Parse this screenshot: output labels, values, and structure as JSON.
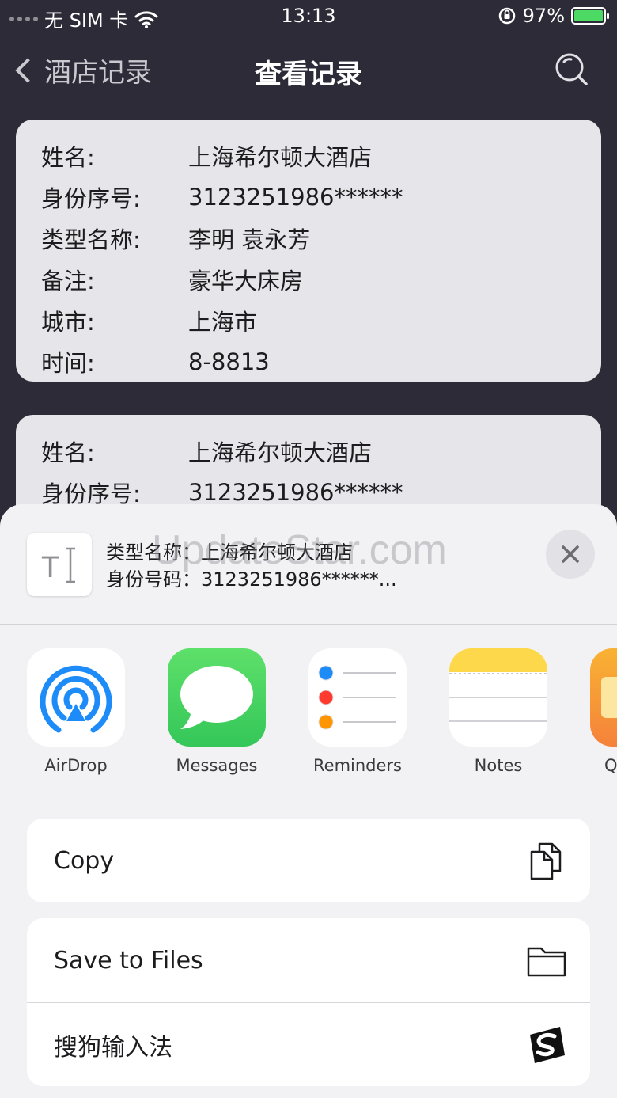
{
  "status_bar": {
    "carrier": "无 SIM 卡",
    "time": "13:13",
    "battery_pct": "97%",
    "icons": [
      "signal-dots-icon",
      "wifi-icon",
      "orientation-lock-icon",
      "battery-charging-icon"
    ]
  },
  "nav": {
    "back_label": "酒店记录",
    "title": "查看记录",
    "search_icon": "search-icon"
  },
  "records": [
    {
      "rows": [
        {
          "key": "姓名:",
          "value": "上海希尔顿大酒店"
        },
        {
          "key": "身份序号:",
          "value": "3123251986******"
        },
        {
          "key": "类型名称:",
          "value": "李明 袁永芳"
        },
        {
          "key": "备注:",
          "value": "豪华大床房"
        },
        {
          "key": "城市:",
          "value": "上海市"
        },
        {
          "key": "时间:",
          "value": "8-8813"
        }
      ]
    },
    {
      "rows": [
        {
          "key": "姓名:",
          "value": "上海希尔顿大酒店"
        },
        {
          "key": "身份序号:",
          "value": "3123251986******"
        }
      ]
    }
  ],
  "share_sheet": {
    "preview_line1": "类型名称：上海希尔顿大酒店",
    "preview_line2": "身份号码：3123251986******...",
    "watermark": "UpdateStar.com",
    "apps": [
      {
        "label": "AirDrop",
        "icon": "airdrop-icon"
      },
      {
        "label": "Messages",
        "icon": "messages-icon"
      },
      {
        "label": "Reminders",
        "icon": "reminders-icon"
      },
      {
        "label": "Notes",
        "icon": "notes-icon"
      },
      {
        "label": "Q",
        "icon": "partial-app-icon"
      }
    ],
    "actions": [
      {
        "label": "Copy",
        "icon": "copy-icon"
      },
      {
        "label": "Save to Files",
        "icon": "folder-icon"
      },
      {
        "label": "搜狗输入法",
        "icon": "sogou-icon"
      }
    ]
  },
  "colors": {
    "background": "#2c2b37",
    "card": "#e6e6ea",
    "sheet": "#f2f2f5",
    "battery": "#4cd964",
    "messages_green": "#34c759",
    "airdrop_blue": "#1d8cf8",
    "notes_yellow": "#fdd84a"
  }
}
